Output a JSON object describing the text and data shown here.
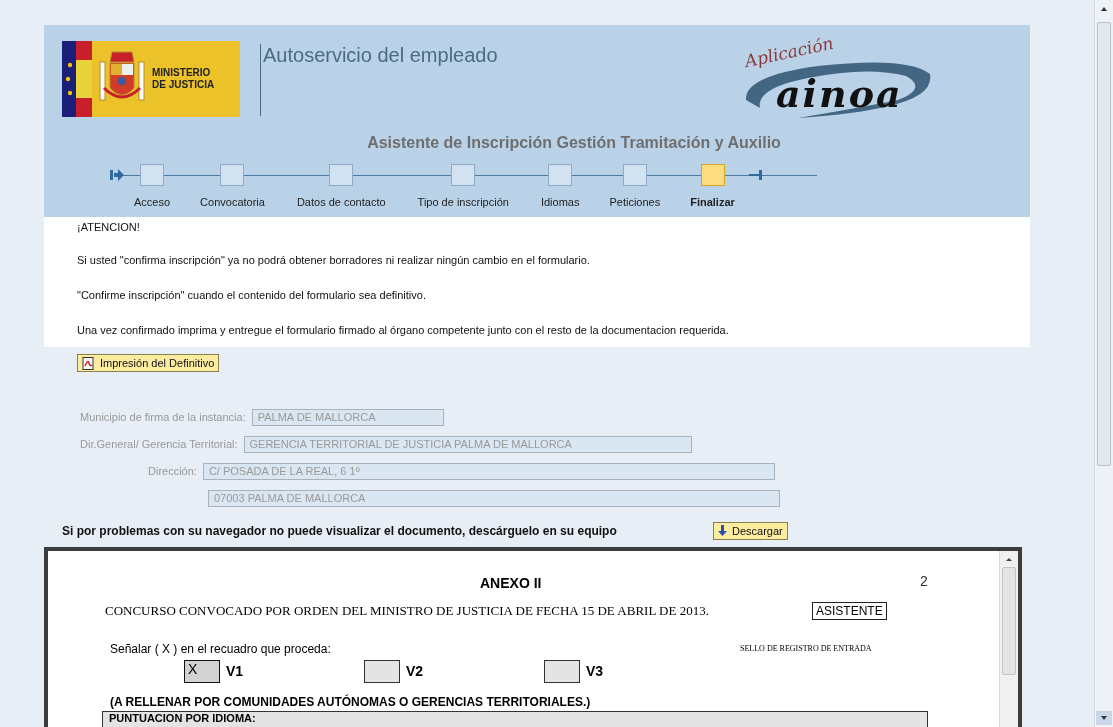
{
  "header": {
    "ministry": "MINISTERIO\nDE JUSTICIA",
    "title": "Autoservicio del empleado",
    "app_logo_top": "Aplicación",
    "app_logo_main": "ainoa",
    "wizard_title": "Asistente de Inscripción Gestión Tramitación y Auxilio"
  },
  "steps": [
    {
      "label": "Acceso",
      "selected": false
    },
    {
      "label": "Convocatoria",
      "selected": false
    },
    {
      "label": "Datos de contacto",
      "selected": false
    },
    {
      "label": "Tipo de inscripción",
      "selected": false
    },
    {
      "label": "Idiomas",
      "selected": false
    },
    {
      "label": "Peticiones",
      "selected": false
    },
    {
      "label": "Finalizar",
      "selected": true
    }
  ],
  "notice": [
    "¡ATENCION!",
    "Si usted \"confirma inscripción\" ya no podrá obtener borradores ni realizar ningún cambio en el formulario.",
    "\"Confirme inscripción\" cuando el contenido del formulario sea definitivo.",
    "Una vez confirmado imprima y entregue el formulario firmado al órgano competente junto con el resto de la documentacion requerida."
  ],
  "print_button": "Impresión del Definitivo",
  "fields": [
    {
      "label": "Municipio de firma de la instancia:",
      "value": "PALMA DE MALLORCA",
      "disabled": true
    },
    {
      "label": "Dir.General/ Gerencia Territorial:",
      "value": "GERENCIA TERRITORIAL DE JUSTICIA PALMA DE MALLORCA",
      "disabled": true
    },
    {
      "label": "Dirección:",
      "value": "C/ POSADA DE LA REAL, 6 1º",
      "disabled": true
    },
    {
      "value": "07003 PALMA DE MALLORCA",
      "disabled": true
    }
  ],
  "download": {
    "text": "Si por problemas con su navegador no puede visualizar el documento, descárguelo en su equipo",
    "button": "Descargar"
  },
  "document": {
    "heading": "ANEXO II",
    "page_number": "2",
    "convocation": "CONCURSO CONVOCADO POR ORDEN DEL MINISTRO DE JUSTICIA DE FECHA 15 DE ABRIL DE 2013.",
    "category": "ASISTENTE",
    "instruction": "Señalar ( X ) en el recuadro que proceda:",
    "stamp": "SELLO DE REGISTRO DE ENTRADA",
    "options": [
      {
        "label": "V1",
        "checked": true,
        "mark": "X"
      },
      {
        "label": "V2",
        "checked": false
      },
      {
        "label": "V3",
        "checked": false
      }
    ],
    "section": "(A RELLENAR POR COMUNIDADES AUTÓNOMAS O GERENCIAS TERRITORIALES.)",
    "table_heading": "PUNTUACION POR IDIOMA:"
  }
}
